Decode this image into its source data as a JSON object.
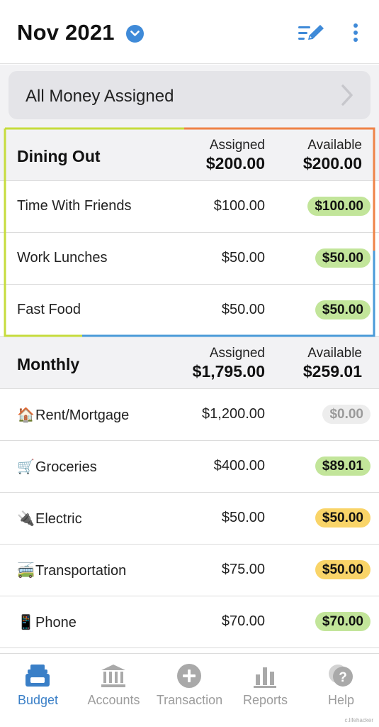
{
  "header": {
    "month": "Nov 2021"
  },
  "banner": {
    "label": "All Money Assigned"
  },
  "groups": [
    {
      "name": "Dining Out",
      "assigned_label": "Assigned",
      "available_label": "Available",
      "assigned": "$200.00",
      "available": "$200.00",
      "rows": [
        {
          "name": "Time With Friends",
          "assigned": "$100.00",
          "available": "$100.00",
          "status": "green"
        },
        {
          "name": "Work Lunches",
          "assigned": "$50.00",
          "available": "$50.00",
          "status": "green"
        },
        {
          "name": "Fast Food",
          "assigned": "$50.00",
          "available": "$50.00",
          "status": "green"
        }
      ]
    },
    {
      "name": "Monthly",
      "assigned_label": "Assigned",
      "available_label": "Available",
      "assigned": "$1,795.00",
      "available": "$259.01",
      "rows": [
        {
          "emoji": "🏠",
          "name": "Rent/Mortgage",
          "assigned": "$1,200.00",
          "available": "$0.00",
          "status": "gray"
        },
        {
          "emoji": "🛒",
          "name": "Groceries",
          "assigned": "$400.00",
          "available": "$89.01",
          "status": "green"
        },
        {
          "emoji": "🔌",
          "name": "Electric",
          "assigned": "$50.00",
          "available": "$50.00",
          "status": "yellow"
        },
        {
          "emoji": "🚎",
          "name": "Transportation",
          "assigned": "$75.00",
          "available": "$50.00",
          "status": "yellow"
        },
        {
          "emoji": "📱",
          "name": "Phone",
          "assigned": "$70.00",
          "available": "$70.00",
          "status": "green"
        }
      ]
    }
  ],
  "nav": {
    "budget": "Budget",
    "accounts": "Accounts",
    "transaction": "Transaction",
    "reports": "Reports",
    "help": "Help"
  },
  "colors": {
    "accent": "#3a7fc7",
    "pill_green": "#c2e59a",
    "pill_yellow": "#f9d468",
    "pill_gray": "#ededed",
    "frame_yellowgreen": "#c6dc3c",
    "frame_orange": "#ef8347",
    "frame_blue": "#4a9ad8"
  },
  "watermark": "c.lifehacker"
}
